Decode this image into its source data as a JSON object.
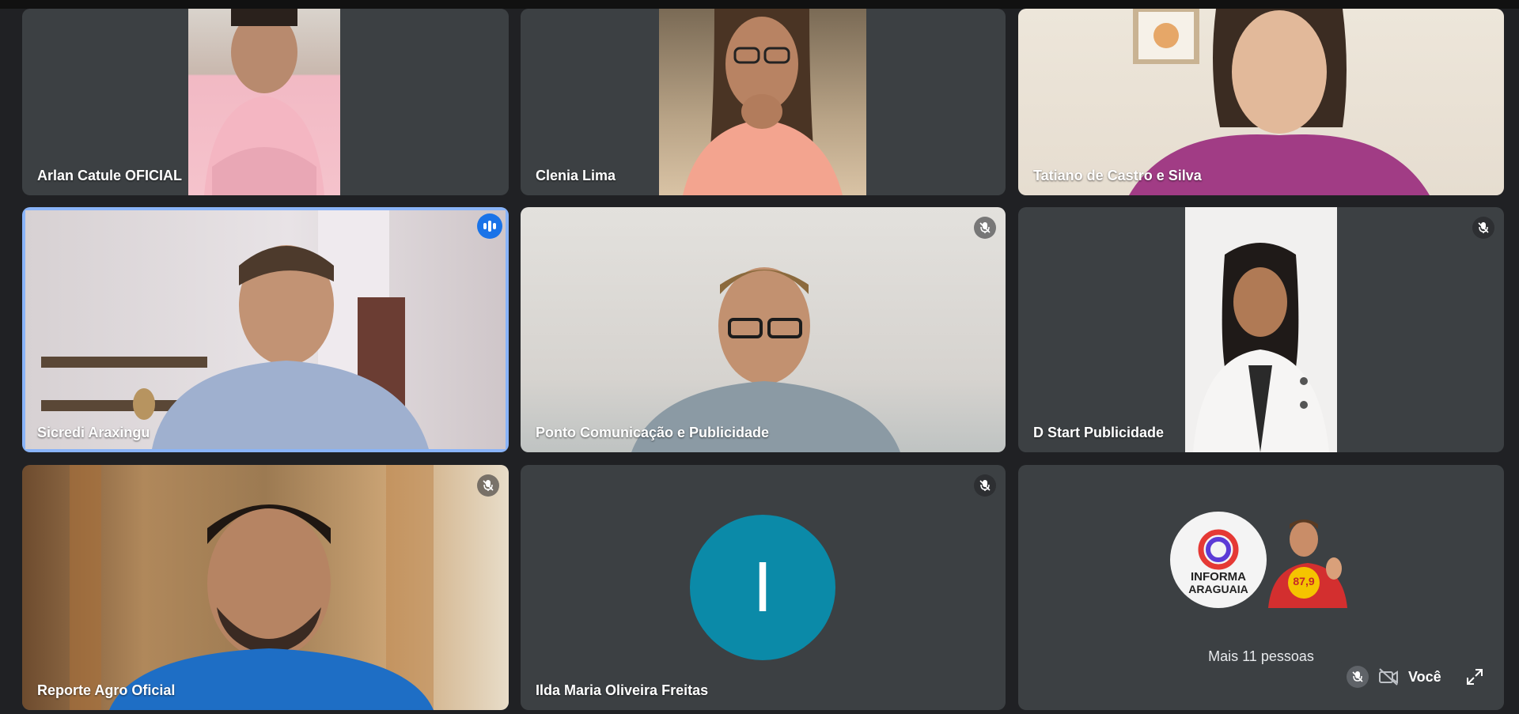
{
  "colors": {
    "background": "#202124",
    "tile": "#3c4043",
    "speaking_border": "#8ab4f8",
    "speaking_badge": "#1a73e8",
    "avatar_ilda": "#0b8aa8"
  },
  "participants": [
    {
      "name": "Arlan Catule OFICIAL",
      "video": true,
      "muted": false
    },
    {
      "name": "Clenia Lima",
      "video": true,
      "muted": false
    },
    {
      "name": "Tatiano de Castro e Silva",
      "video": true,
      "muted": false
    },
    {
      "name": "Sicredi Araxingu",
      "video": true,
      "speaking": true
    },
    {
      "name": "Ponto Comunicação e Publicidade",
      "video": true,
      "muted": true
    },
    {
      "name": "D Start Publicidade",
      "video": true,
      "muted": true
    },
    {
      "name": "Reporte Agro Oficial",
      "video": true,
      "muted": true
    },
    {
      "name": "Ilda Maria Oliveira Freitas",
      "video": false,
      "muted": true,
      "avatar_letter": "I"
    }
  ],
  "overflow_tile": {
    "label": "Mais 11 pessoas",
    "logo_line1": "INFORMA",
    "logo_line2": "ARAGUAIA",
    "badge_text": "87,9"
  },
  "self_view": {
    "label": "Você",
    "icons": [
      "mic-off-icon",
      "camera-off-icon",
      "expand-icon"
    ]
  }
}
